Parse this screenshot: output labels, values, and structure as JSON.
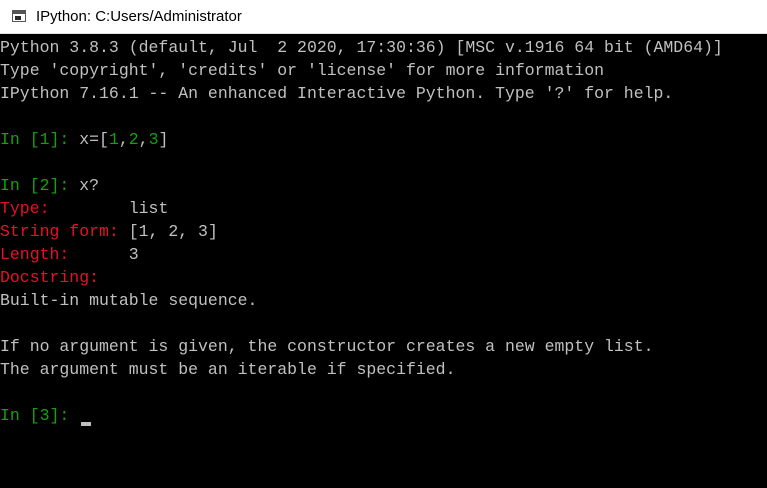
{
  "window": {
    "title": "IPython: C:Users/Administrator"
  },
  "banner": [
    "Python 3.8.3 (default, Jul  2 2020, 17:30:36) [MSC v.1916 64 bit (AMD64)]",
    "Type 'copyright', 'credits' or 'license' for more information",
    "IPython 7.16.1 -- An enhanced Interactive Python. Type '?' for help."
  ],
  "cell1": {
    "prompt": "In [",
    "number": "1",
    "prompt_close": "]: ",
    "code_prefix": "x=[",
    "n1": "1",
    "sep1": ",",
    "n2": "2",
    "sep2": ",",
    "n3": "3",
    "code_suffix": "]"
  },
  "cell2": {
    "prompt": "In [",
    "number": "2",
    "prompt_close": "]: ",
    "code": "x?"
  },
  "help": {
    "type_label": "Type:",
    "type_pad": "        ",
    "type_value": "list",
    "string_form_label": "String form:",
    "string_form_pad": " ",
    "string_form_value": "[1, 2, 3]",
    "length_label": "Length:",
    "length_pad": "      ",
    "length_value": "3",
    "docstring_label": "Docstring:",
    "doc_lines": [
      "Built-in mutable sequence.",
      "",
      "If no argument is given, the constructor creates a new empty list.",
      "The argument must be an iterable if specified."
    ]
  },
  "cell3": {
    "prompt": "In [",
    "number": "3",
    "prompt_close": "]: "
  },
  "colors": {
    "prompt_green": "#13a10e",
    "label_red": "#e81123",
    "text_gray": "#c0c0c0",
    "background": "#000000"
  }
}
